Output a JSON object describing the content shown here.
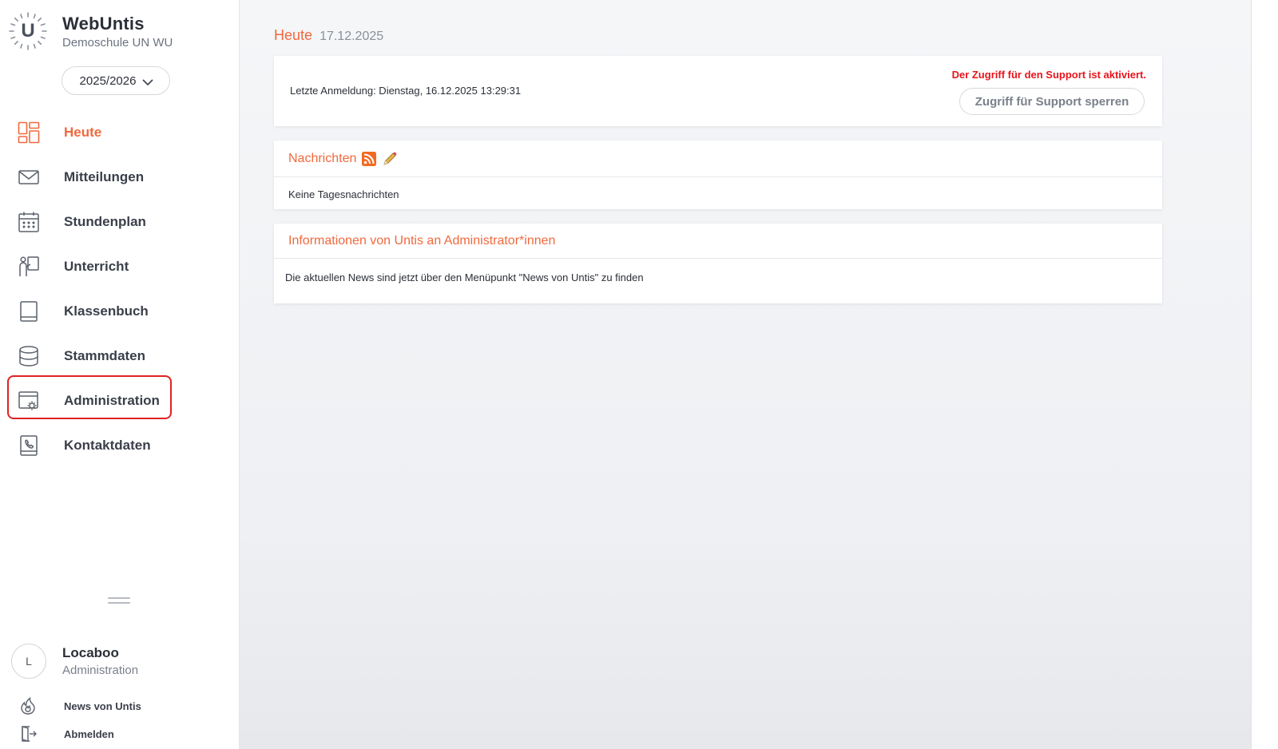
{
  "brand": {
    "title": "WebUntis",
    "school": "Demoschule UN WU",
    "logo_letter": "U"
  },
  "year_selector": {
    "value": "2025/2026"
  },
  "nav": {
    "items": [
      {
        "id": "heute",
        "label": "Heute",
        "icon": "dashboard-icon",
        "active": true
      },
      {
        "id": "mitteilungen",
        "label": "Mitteilungen",
        "icon": "envelope-icon"
      },
      {
        "id": "stundenplan",
        "label": "Stundenplan",
        "icon": "calendar-icon"
      },
      {
        "id": "unterricht",
        "label": "Unterricht",
        "icon": "teacher-board-icon"
      },
      {
        "id": "klassenbuch",
        "label": "Klassenbuch",
        "icon": "book-icon"
      },
      {
        "id": "stammdaten",
        "label": "Stammdaten",
        "icon": "database-icon"
      },
      {
        "id": "administration",
        "label": "Administration",
        "icon": "admin-settings-icon",
        "highlighted": true
      },
      {
        "id": "kontaktdaten",
        "label": "Kontaktdaten",
        "icon": "contact-book-icon"
      }
    ]
  },
  "user": {
    "initial": "L",
    "name": "Locaboo",
    "role": "Administration"
  },
  "bottom_links": {
    "news": "News von Untis",
    "logout": "Abmelden"
  },
  "main": {
    "heading_word": "Heute",
    "heading_date": "17.12.2025",
    "login_info": "Letzte Anmeldung: Dienstag, 16.12.2025 13:29:31",
    "support_warning": "Der Zugriff für den Support ist aktiviert.",
    "support_button": "Zugriff für Support sperren",
    "news_title": "Nachrichten",
    "news_body": "Keine Tagesnachrichten",
    "info_title": "Informationen von Untis an Administrator*innen",
    "info_body": "Die aktuellen News sind jetzt über den Menüpunkt \"News von Untis\" zu finden"
  },
  "colors": {
    "accent": "#f0693d",
    "warning": "#e8141b",
    "highlight": "#e02222"
  }
}
